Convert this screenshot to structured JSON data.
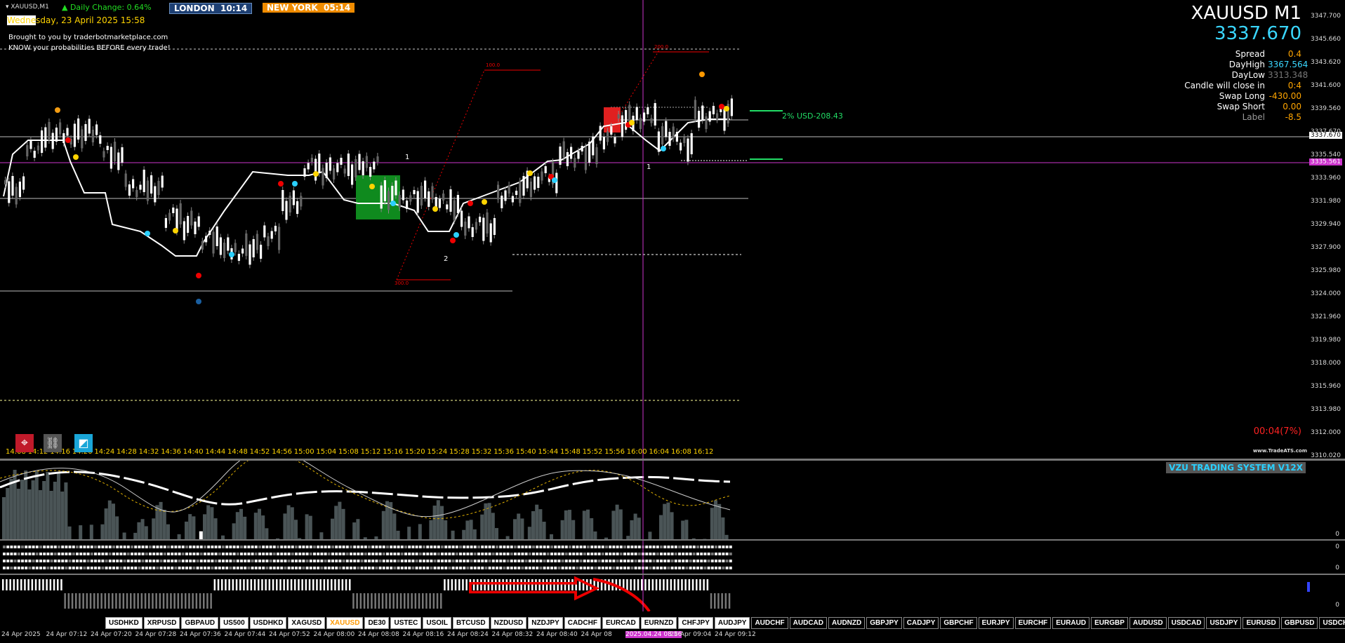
{
  "header": {
    "symbol_tf": "XAUUSD,M1",
    "daily_change": "▲ Daily Change: 0.64%",
    "london_label": "LONDON",
    "london_time": "10:14",
    "newyork_label": "NEW YORK",
    "newyork_time": "05:14",
    "date_line_hl": "Wedne",
    "date_line": "sday, 23 April 2025 15:58",
    "promo1": "Brought to you by traderbotmarketplace.com",
    "promo2": "KNOW your probabilities BEFORE every trade!"
  },
  "info": {
    "title": "XAUUSD M1",
    "price": "3337.670",
    "rows": [
      {
        "k": "Spread",
        "v": "0.4"
      },
      {
        "k": "DayHigh",
        "v": "3367.564"
      },
      {
        "k": "DayLow",
        "v": "3313.348"
      },
      {
        "k": "Candle will close in",
        "v": "0:4"
      },
      {
        "k": "Swap Long",
        "v": "-430.00"
      },
      {
        "k": "Swap Short",
        "v": "0.00"
      },
      {
        "k": "Label",
        "v": "-8.5"
      }
    ],
    "countdown": "00:04(7%)",
    "watermark": "www.TradeATS.com",
    "risk_label": "2% USD-208.43",
    "fib_top": "100.0",
    "fib_mid": "200.0",
    "fib_low": "300.0"
  },
  "price_axis": [
    "3347.700",
    "3345.660",
    "3343.620",
    "3341.600",
    "3339.560",
    "3337.670",
    "3335.540",
    "3333.960",
    "3331.980",
    "3329.940",
    "3327.900",
    "3325.980",
    "3324.000",
    "3321.960",
    "3319.980",
    "3318.000",
    "3315.960",
    "3313.980",
    "3312.000",
    "3310.020"
  ],
  "current_price_tag": "3337.670",
  "magenta_price_tag": "3335.561",
  "time_axis": [
    "14:08",
    "14:12",
    "14:16",
    "14:20",
    "14:24",
    "14:28",
    "14:32",
    "14:36",
    "14:40",
    "14:44",
    "14:48",
    "14:52",
    "14:56",
    "15:00",
    "15:04",
    "15:08",
    "15:12",
    "15:16",
    "15:20",
    "15:24",
    "15:28",
    "15:32",
    "15:36",
    "15:40",
    "15:44",
    "15:48",
    "15:52",
    "15:56",
    "16:00",
    "16:04",
    "16:08",
    "16:12"
  ],
  "bottom_time_axis": [
    "24 Apr 2025",
    "24 Apr 07:12",
    "24 Apr 07:20",
    "24 Apr 07:28",
    "24 Apr 07:36",
    "24 Apr 07:44",
    "24 Apr 07:52",
    "24 Apr 08:00",
    "24 Apr 08:08",
    "24 Apr 08:16",
    "24 Apr 08:24",
    "24 Apr 08:32",
    "24 Apr 08:40",
    "24 Apr 08",
    "2025.04.24 08:56",
    "24 Apr 09:04",
    "24 Apr 09:12"
  ],
  "chart_labels": {
    "wave1": "1",
    "wave2": "2",
    "wave1b": "1"
  },
  "indicator": {
    "name": "VZU TRADING SYSTEM V12X",
    "zero1": "0",
    "zero2": "0",
    "zero3": "0",
    "zero4": "0"
  },
  "symbols": [
    "USDHKD",
    "XRPUSD",
    "GBPAUD",
    "US500",
    "USDHKD",
    "XAGUSD",
    "XAUUSD",
    "DE30",
    "USTEC",
    "USOIL",
    "BTCUSD",
    "NZDUSD",
    "NZDJPY",
    "CADCHF",
    "EURCAD",
    "EURNZD",
    "CHFJPY",
    "AUDJPY",
    "AUDCHF",
    "AUDCAD",
    "AUDNZD",
    "GBPJPY",
    "CADJPY",
    "GBPCHF",
    "EURJPY",
    "EURCHF",
    "EURAUD",
    "EURGBP",
    "AUDUSD",
    "USDCAD",
    "USDJPY",
    "EURUSD",
    "GBPUSD",
    "USDCHF"
  ],
  "active_symbol": "XAUUSD",
  "colors": {
    "accent_cyan": "#3ad7ff",
    "london_bg": "#1d3f73",
    "newyork_bg": "#f08c00",
    "magenta": "#cc33cc"
  }
}
